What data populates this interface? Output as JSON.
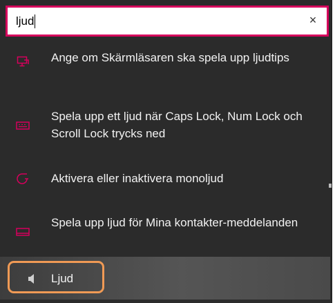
{
  "search": {
    "value": "ljud",
    "clear_glyph": "×"
  },
  "results": [
    {
      "label": "Ange om Skärmläsaren ska spela upp ljudtips",
      "icon": "screen-reader-icon"
    },
    {
      "label": "Spela upp ett ljud när Caps Lock, Num Lock och Scroll Lock trycks ned",
      "icon": "keyboard-icon"
    },
    {
      "label": "Aktivera eller inaktivera monoljud",
      "icon": "ease-of-access-icon"
    },
    {
      "label": "Spela upp ljud för Mina kontakter-meddelanden",
      "icon": "taskbar-icon"
    },
    {
      "label": "Ljud",
      "icon": "speaker-icon"
    }
  ],
  "colors": {
    "accent": "#d6005c",
    "panel_bg": "#2b2b2b",
    "text": "#f2f2f2",
    "highlight_outline": "#f09a55"
  }
}
